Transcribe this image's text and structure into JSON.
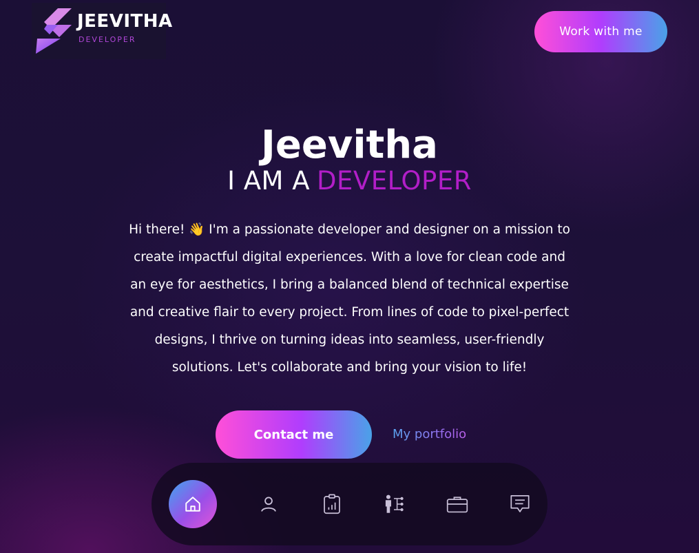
{
  "logo": {
    "title": "JEEVITHA",
    "subtitle": "DEVELOPER"
  },
  "header": {
    "cta_label": "Work with me"
  },
  "hero": {
    "name": "Jeevitha",
    "role_prefix": "I AM A",
    "role_accent": "DEVELOPER",
    "bio": "Hi there! 👋 I'm a passionate developer and designer on a mission to create impactful digital experiences. With a love for clean code and an eye for aesthetics, I bring a balanced blend of technical expertise and creative flair to every project. From lines of code to pixel-perfect designs, I thrive on turning ideas into seamless, user-friendly solutions. Let's collaborate and bring your vision to life!"
  },
  "actions": {
    "contact_label": "Contact me",
    "portfolio_label": "My portfolio"
  },
  "nav": {
    "items": [
      {
        "icon": "home-icon",
        "active": true
      },
      {
        "icon": "user-icon",
        "active": false
      },
      {
        "icon": "clipboard-chart-icon",
        "active": false
      },
      {
        "icon": "skills-tree-icon",
        "active": false
      },
      {
        "icon": "briefcase-icon",
        "active": false
      },
      {
        "icon": "message-icon",
        "active": false
      }
    ]
  },
  "colors": {
    "accent_pink": "#ff4fd8",
    "accent_purple": "#b21ec8",
    "accent_blue": "#4aa2e8",
    "background": "#1d1038"
  }
}
